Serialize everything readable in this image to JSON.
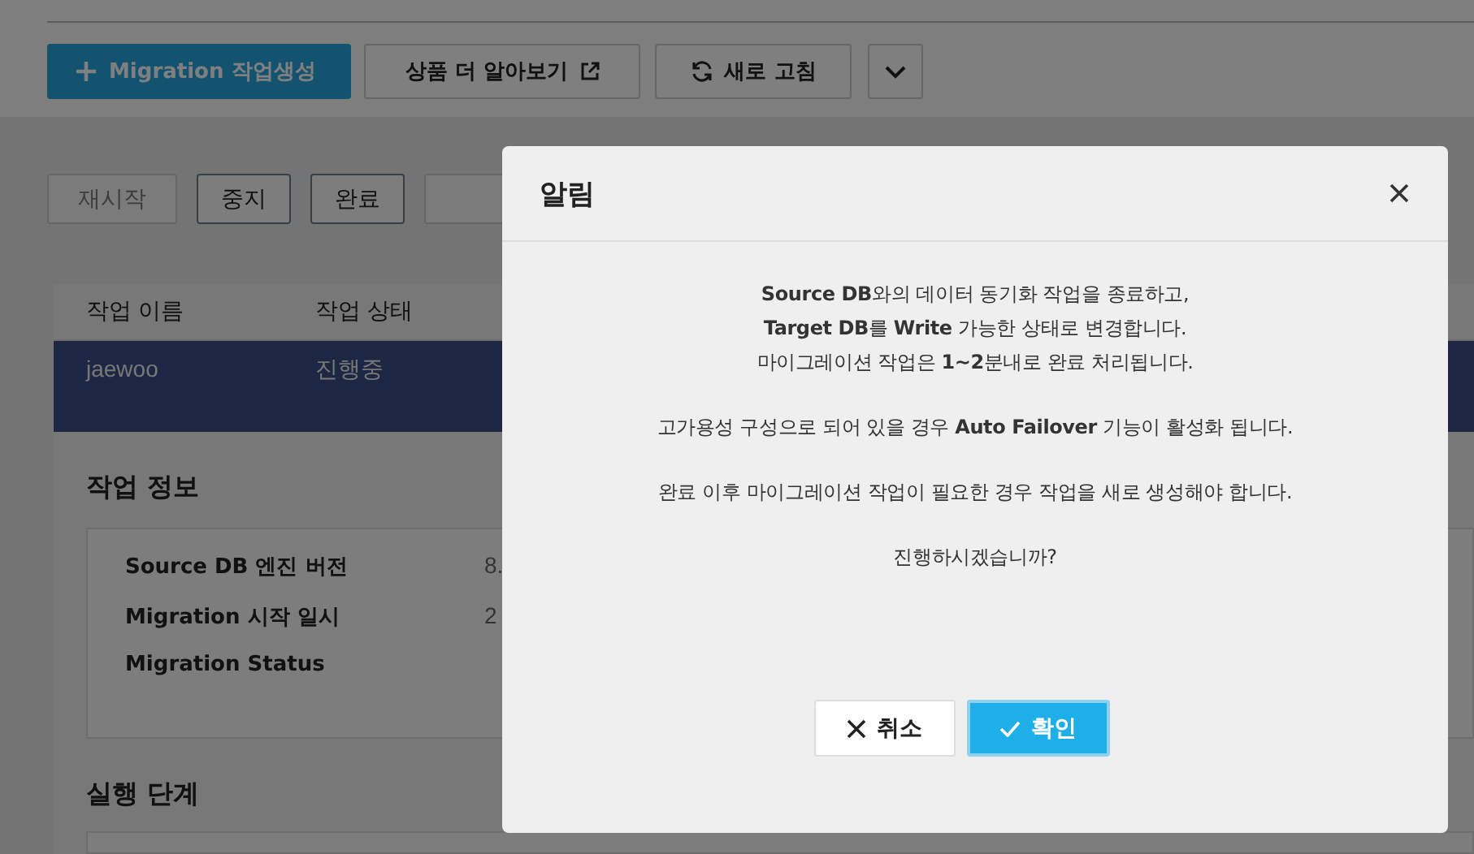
{
  "toolbar": {
    "buttons": [
      {
        "kind": "create",
        "label": "Migration 작업생성"
      },
      {
        "kind": "external",
        "label": "상품 더 알아보기"
      },
      {
        "kind": "refresh",
        "label": "새로 고침"
      },
      {
        "kind": "more"
      }
    ]
  },
  "actions": [
    {
      "label": "재시작",
      "disabled": true
    },
    {
      "label": "중지",
      "disabled": false
    },
    {
      "label": "완료",
      "disabled": false
    },
    {
      "disabled": true
    }
  ],
  "table": {
    "columns": [
      "작업 이름",
      "작업 상태"
    ],
    "rows": [
      {
        "cells": [
          "jaewoo",
          "진행중"
        ],
        "selected": true
      }
    ]
  },
  "job_info": {
    "title": "작업 정보",
    "fields": [
      {
        "label": "Source DB 엔진 버전",
        "value": "8."
      },
      {
        "label": "Migration 시작 일시",
        "value": "2"
      },
      {
        "label": "Migration Status"
      }
    ]
  },
  "steps": {
    "title": "실행 단계"
  },
  "dialog": {
    "title": "알림",
    "paragraphs": [
      {
        "lines": [
          "**Source DB**와의 데이터 동기화 작업을 종료하고,",
          "**Target DB**를 **Write** 가능한 상태로 변경합니다.",
          "마이그레이션 작업은 **1~2**분내로 완료 처리됩니다."
        ]
      },
      {
        "lines": [
          "고가용성 구성으로 되어 있을 경우 **Auto Failover** 기능이 활성화 됩니다."
        ]
      },
      {
        "lines": [
          "완료 이후 마이그레이션 작업이 필요한 경우 작업을 새로 생성해야 합니다."
        ]
      },
      {
        "lines": [
          "진행하시겠습니까?"
        ]
      }
    ],
    "buttons": [
      {
        "kind": "cancel",
        "label": "취소"
      },
      {
        "kind": "confirm",
        "label": "확인"
      }
    ]
  }
}
